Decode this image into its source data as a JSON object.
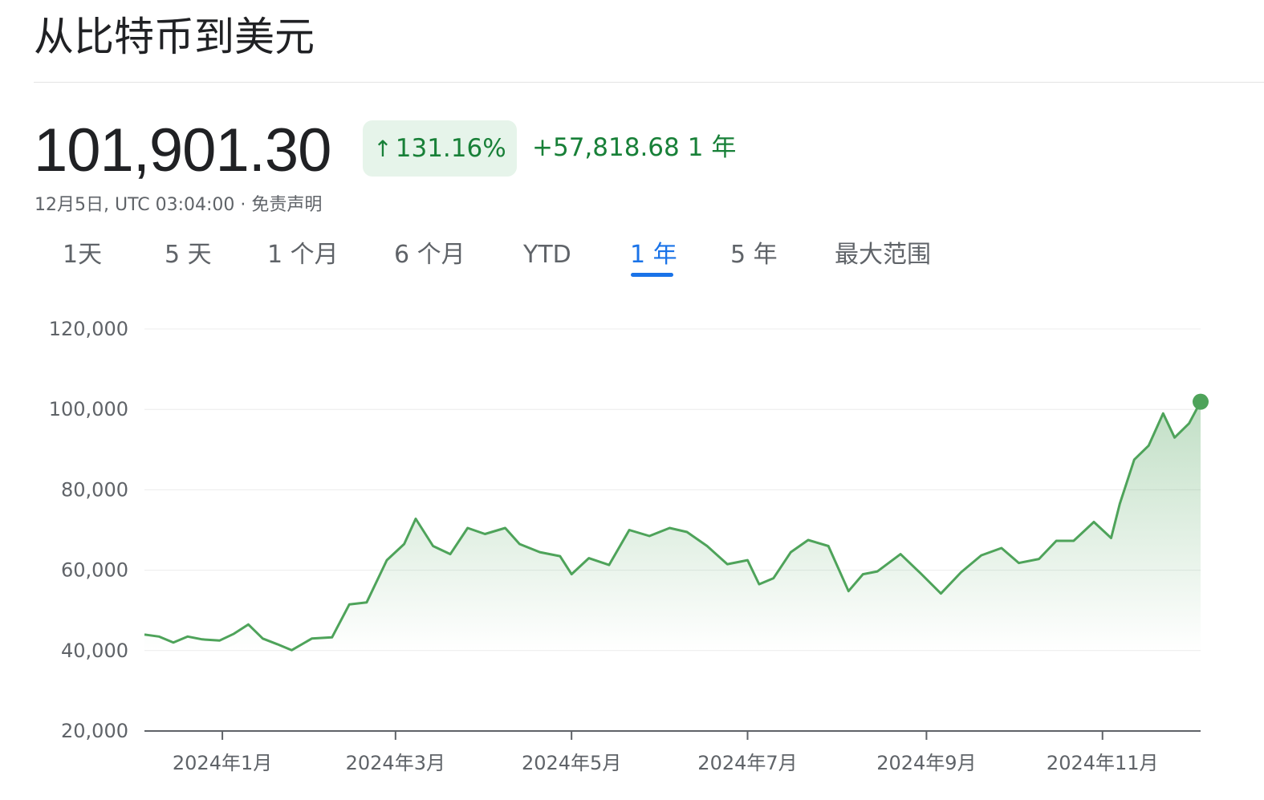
{
  "title": "从比特币到美元",
  "price": "101,901.30",
  "change_percent": "131.16%",
  "change_arrow": "↑",
  "change_value": "+57,818.68",
  "change_period": "1 年",
  "timestamp": "12月5日, UTC 03:04:00 · 免责声明",
  "tabs": [
    {
      "label": "1天"
    },
    {
      "label": "5 天"
    },
    {
      "label": "1 个月"
    },
    {
      "label": "6 个月"
    },
    {
      "label": "YTD"
    },
    {
      "label": "1 年"
    },
    {
      "label": "5 年"
    },
    {
      "label": "最大范围"
    }
  ],
  "active_tab": "1 年",
  "colors": {
    "line": "#4ea35a",
    "positive": "#188038",
    "accent": "#1a73e8",
    "badge_bg": "#e6f4ea"
  },
  "chart_data": {
    "type": "area",
    "title": "",
    "xlabel": "",
    "ylabel": "",
    "y_ticks": [
      "120,000",
      "100,000",
      "80,000",
      "60,000",
      "40,000",
      "20,000"
    ],
    "y_tick_values": [
      120000,
      100000,
      80000,
      60000,
      40000,
      20000
    ],
    "ylim": [
      20000,
      120000
    ],
    "x_ticks": [
      "2024年1月",
      "2024年3月",
      "2024年5月",
      "2024年7月",
      "2024年9月",
      "2024年11月"
    ],
    "x_tick_dates": [
      "2024-01-01",
      "2024-03-01",
      "2024-05-01",
      "2024-07-01",
      "2024-09-01",
      "2024-11-01"
    ],
    "xlim": [
      "2023-12-05",
      "2024-12-05"
    ],
    "grid": true,
    "series": [
      {
        "x": [
          "2023-12-05",
          "2023-12-10",
          "2023-12-15",
          "2023-12-20",
          "2023-12-25",
          "2023-12-31",
          "2024-01-05",
          "2024-01-10",
          "2024-01-15",
          "2024-01-20",
          "2024-01-25",
          "2024-02-01",
          "2024-02-08",
          "2024-02-14",
          "2024-02-20",
          "2024-02-27",
          "2024-03-04",
          "2024-03-08",
          "2024-03-14",
          "2024-03-20",
          "2024-03-26",
          "2024-04-01",
          "2024-04-08",
          "2024-04-13",
          "2024-04-20",
          "2024-04-27",
          "2024-05-01",
          "2024-05-07",
          "2024-05-14",
          "2024-05-21",
          "2024-05-28",
          "2024-06-04",
          "2024-06-10",
          "2024-06-17",
          "2024-06-24",
          "2024-07-01",
          "2024-07-05",
          "2024-07-10",
          "2024-07-16",
          "2024-07-22",
          "2024-07-29",
          "2024-08-05",
          "2024-08-10",
          "2024-08-15",
          "2024-08-23",
          "2024-08-30",
          "2024-09-06",
          "2024-09-13",
          "2024-09-20",
          "2024-09-27",
          "2024-10-03",
          "2024-10-10",
          "2024-10-16",
          "2024-10-22",
          "2024-10-29",
          "2024-11-04",
          "2024-11-07",
          "2024-11-12",
          "2024-11-17",
          "2024-11-22",
          "2024-11-26",
          "2024-12-01",
          "2024-12-05"
        ],
        "values": [
          44000,
          43500,
          42000,
          43500,
          42800,
          42500,
          44200,
          46500,
          43000,
          41600,
          40100,
          43000,
          43300,
          51500,
          52000,
          62500,
          66500,
          72800,
          66000,
          64000,
          70500,
          69000,
          70500,
          66500,
          64500,
          63500,
          59000,
          63000,
          61300,
          70000,
          68500,
          70500,
          69500,
          66000,
          61500,
          62500,
          56500,
          58000,
          64500,
          67500,
          66000,
          54800,
          59000,
          59700,
          64000,
          59200,
          54200,
          59500,
          63700,
          65500,
          61800,
          62800,
          67300,
          67300,
          72000,
          68000,
          76500,
          87500,
          91000,
          99000,
          93000,
          96500,
          101901
        ]
      }
    ]
  }
}
